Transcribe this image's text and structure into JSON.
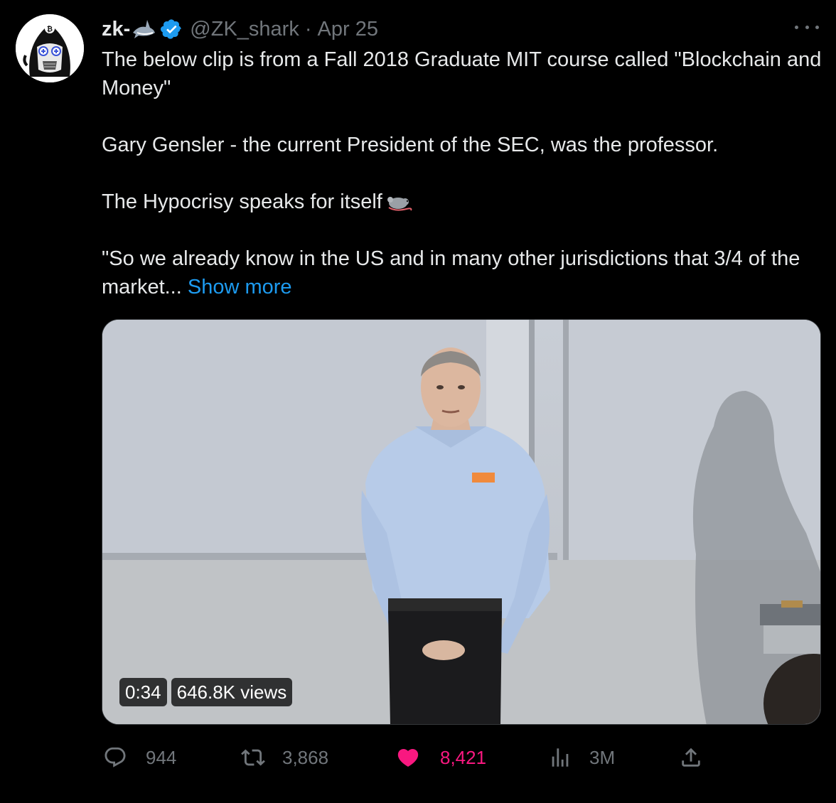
{
  "author": {
    "display_name": "zk-",
    "handle": "@ZK_shark",
    "separator": "·",
    "date": "Apr 25",
    "verified": true,
    "emoji": "shark-emoji"
  },
  "tweet": {
    "paragraphs": [
      "The below clip is from a Fall 2018 Graduate MIT course called \"Blockchain and Money\"",
      "Gary Gensler - the current President of the SEC, was the professor.",
      "The Hypocrisy speaks for itself"
    ],
    "last_paragraph": "\"So we already know in the US and in many other jurisdictions that 3/4 of the market...",
    "show_more": "Show more",
    "inline_emoji": "rat-emoji"
  },
  "media": {
    "type": "video",
    "duration": "0:34",
    "views": "646.8K views"
  },
  "actions": {
    "replies": "944",
    "retweets": "3,868",
    "likes": "8,421",
    "views": "3M"
  },
  "colors": {
    "background": "#000000",
    "text": "#e7e9ea",
    "muted": "#71767b",
    "link": "#1d9bf0",
    "like": "#f91880",
    "verified": "#1d9bf0"
  }
}
